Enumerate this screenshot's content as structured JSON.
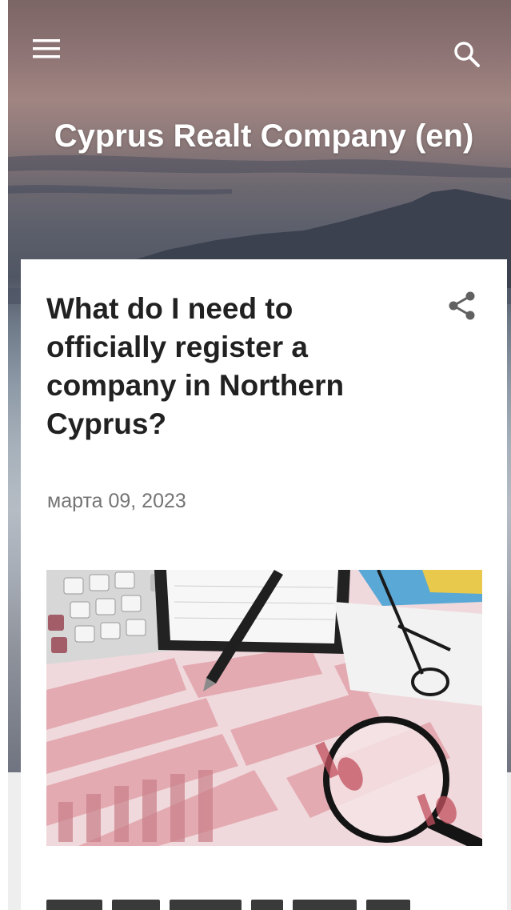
{
  "header": {
    "site_title": "Cyprus Realt Company (en)",
    "menu_icon": "menu-icon",
    "search_icon": "search-icon"
  },
  "post": {
    "title": "What do I need to officially register a company in Northern Cyprus?",
    "date": "марта 09, 2023",
    "share_icon": "share-icon",
    "image_subject": "featured-image"
  },
  "colors": {
    "title_text": "#ffffff",
    "post_title": "#212121",
    "date_text": "#757575",
    "card_bg": "#ffffff"
  }
}
